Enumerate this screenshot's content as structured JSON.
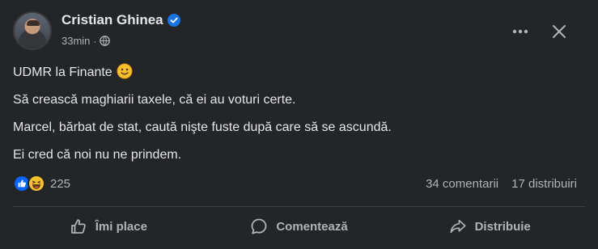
{
  "post": {
    "author": "Cristian Ghinea",
    "time": "33min",
    "separator": "·",
    "lines": [
      "UDMR la Finante",
      "Să crească maghiarii taxele, că ei au voturi certe.",
      "Marcel, bărbat de stat, caută nişte fuste după care să se ascundă.",
      "Ei cred că noi nu ne prindem."
    ]
  },
  "engagement": {
    "reaction_count": "225",
    "comments": "34 comentarii",
    "shares": "17 distribuiri"
  },
  "actions": {
    "like": "Îmi place",
    "comment": "Comentează",
    "share": "Distribuie"
  },
  "icons": {
    "verified": "verified-badge-icon",
    "audience": "globe-icon",
    "more": "more-options-icon",
    "close": "close-icon",
    "emoji": "slightly-smiling-face-icon",
    "reactions": [
      "like-reaction-icon",
      "haha-reaction-icon"
    ]
  },
  "colors": {
    "background": "#242526",
    "primary_text": "#e4e6eb",
    "secondary_text": "#b0b3b8",
    "verified_blue": "#1b74e4",
    "like_blue": "#0866ff"
  }
}
